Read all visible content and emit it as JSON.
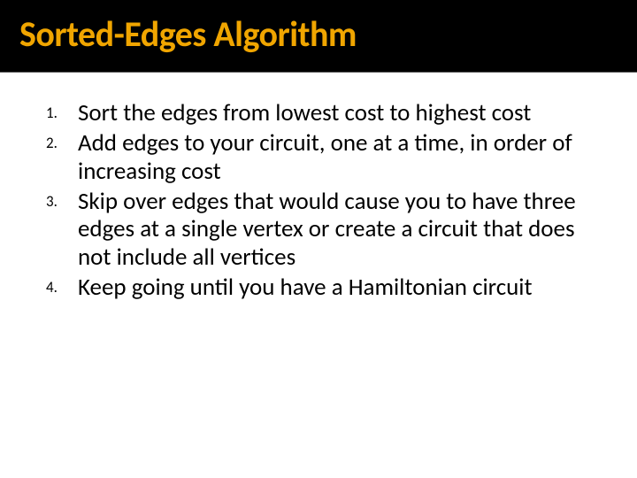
{
  "title": "Sorted-Edges Algorithm",
  "steps": [
    "Sort the edges from lowest cost to highest cost",
    "Add edges to your circuit, one at a time, in order of increasing cost",
    "Skip over edges that would cause you to have three edges at a single vertex or create a circuit that does not include all vertices",
    "Keep going until you have a Hamiltonian circuit"
  ]
}
